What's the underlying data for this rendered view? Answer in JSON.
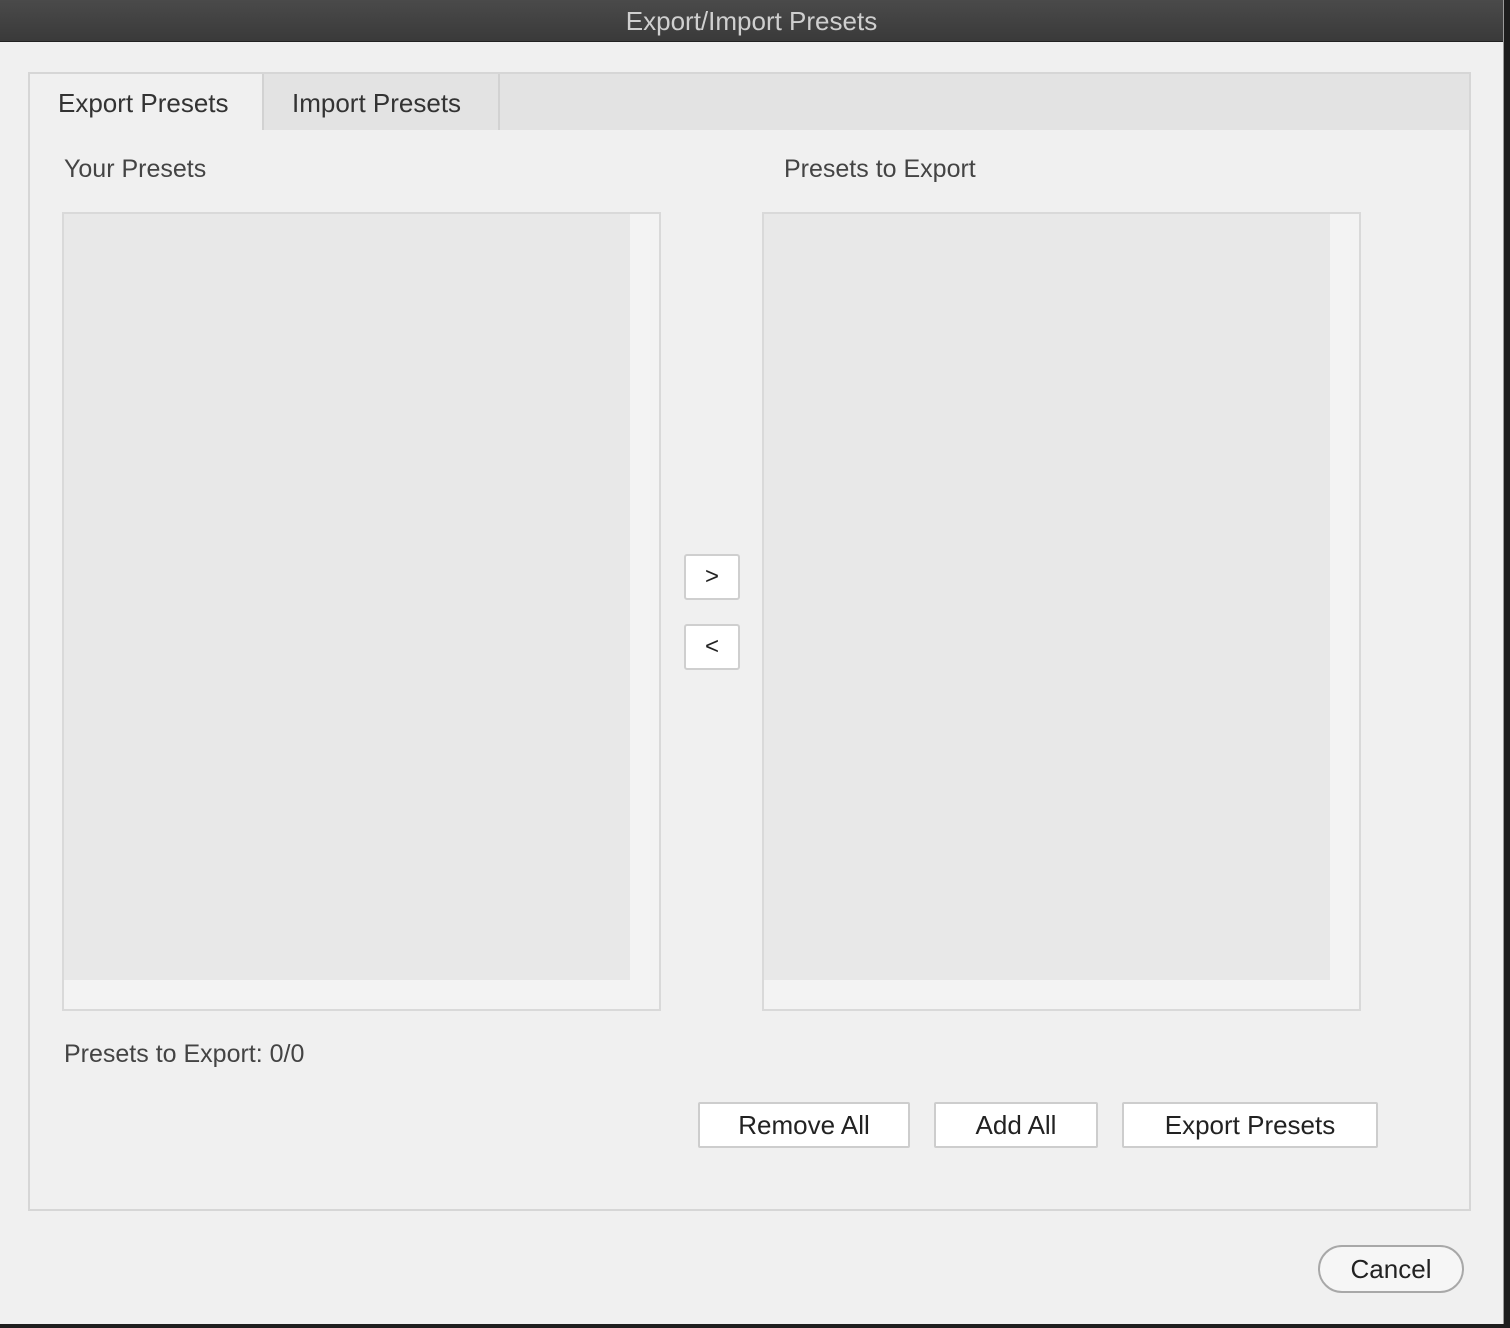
{
  "window": {
    "title": "Export/Import Presets"
  },
  "tabs": [
    {
      "label": "Export Presets",
      "active": true
    },
    {
      "label": "Import Presets",
      "active": false
    }
  ],
  "export_panel": {
    "left_list_label": "Your Presets",
    "right_list_label": "Presets to Export",
    "left_list_items": [],
    "right_list_items": [],
    "move_right_label": ">",
    "move_left_label": "<",
    "status_text": "Presets to Export: 0/0",
    "remove_all_label": "Remove All",
    "add_all_label": "Add All",
    "export_label": "Export Presets"
  },
  "footer": {
    "cancel_label": "Cancel"
  }
}
